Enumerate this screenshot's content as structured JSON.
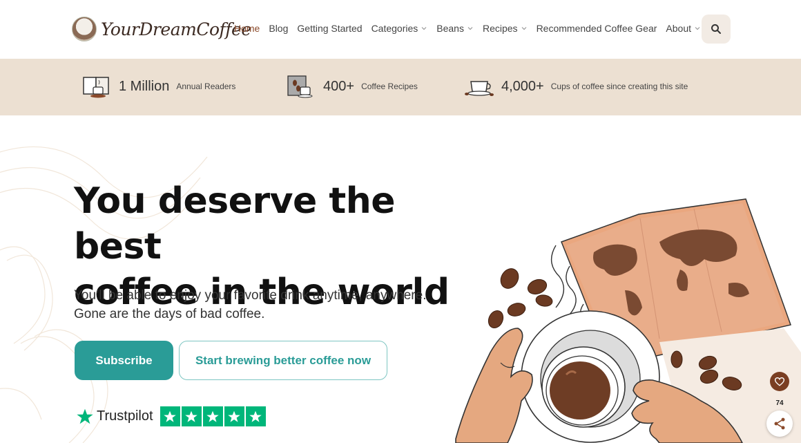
{
  "brand": {
    "name": "YourDreamCoffee"
  },
  "nav": {
    "items": [
      {
        "label": "Home",
        "active": true,
        "dropdown": false
      },
      {
        "label": "Blog",
        "active": false,
        "dropdown": false
      },
      {
        "label": "Getting Started",
        "active": false,
        "dropdown": false
      },
      {
        "label": "Categories",
        "active": false,
        "dropdown": true
      },
      {
        "label": "Beans",
        "active": false,
        "dropdown": true
      },
      {
        "label": "Recipes",
        "active": false,
        "dropdown": true
      },
      {
        "label": "Recommended Coffee Gear",
        "active": false,
        "dropdown": false
      },
      {
        "label": "About",
        "active": false,
        "dropdown": true
      }
    ],
    "search_icon": "search-icon"
  },
  "stats": [
    {
      "value": "1 Million",
      "label": "Annual Readers",
      "icon": "book-coffee-icon"
    },
    {
      "value": "400+",
      "label": "Coffee Recipes",
      "icon": "recipe-card-icon"
    },
    {
      "value": "4,000+",
      "label": "Cups of coffee since creating this site",
      "icon": "coffee-cup-icon"
    }
  ],
  "hero": {
    "title_line1": "You deserve the best",
    "title_line2": "coffee in the world",
    "subtitle": "You’ll be able to enjoy your favorite drink anytime, anywhere. Gone are the days of bad coffee.",
    "subscribe_label": "Subscribe",
    "start_label": "Start brewing better coffee now"
  },
  "trustpilot": {
    "brand": "Trustpilot",
    "stars": 5
  },
  "share": {
    "count": "74"
  },
  "colors": {
    "accent": "#2a9c97",
    "band": "#ece0d2",
    "nav_active": "#8b4a2b",
    "trustpilot": "#00b67a"
  }
}
